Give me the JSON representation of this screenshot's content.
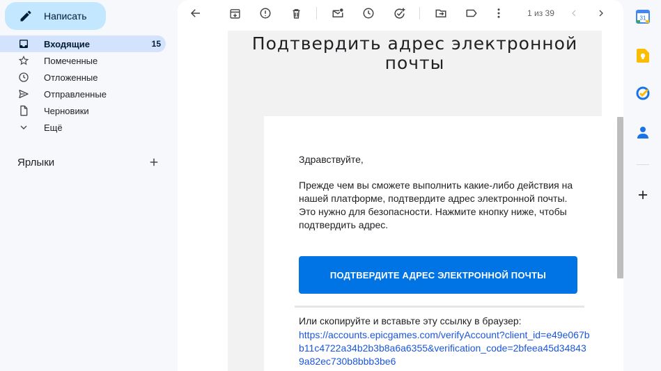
{
  "compose": {
    "label": "Написать"
  },
  "nav": [
    {
      "label": "Входящие",
      "count": "15",
      "icon": "inbox-icon",
      "active": true
    },
    {
      "label": "Помеченные",
      "icon": "star-icon"
    },
    {
      "label": "Отложенные",
      "icon": "clock-icon"
    },
    {
      "label": "Отправленные",
      "icon": "send-icon"
    },
    {
      "label": "Черновики",
      "icon": "draft-icon"
    },
    {
      "label": "Ещё",
      "icon": "chevron-down-icon"
    }
  ],
  "labels": {
    "title": "Ярлыки"
  },
  "toolbar": {
    "icons": [
      "back-arrow-icon",
      "archive-icon",
      "report-spam-icon",
      "delete-icon",
      "mark-unread-icon",
      "snooze-icon",
      "add-task-icon",
      "move-to-icon",
      "label-icon",
      "more-vert-icon"
    ],
    "pager": "1 из 39"
  },
  "email": {
    "title": "Подтвердить адрес электронной почты",
    "greeting": "Здравствуйте,",
    "body": "Прежде чем вы сможете выполнить какие-либо действия на нашей платформе, подтвердите адрес электронной почты. Это нужно для безопасности. Нажмите кнопку ниже, чтобы подтвердить адрес.",
    "button": "ПОДТВЕРДИТЕ АДРЕС ЭЛЕКТРОННОЙ ПОЧТЫ",
    "copy_text": "Или скопируйте и вставьте эту ссылку в браузер:",
    "link": "https://accounts.epicgames.com/verifyAccount?client_id=e49e067bb11c4722a34b2b3b8a6a6355&verification_code=2bfeea45d348439a82ec730b8bbb3be6"
  },
  "rail": {
    "calendar_day": "31",
    "icons": [
      "calendar-icon",
      "keep-icon",
      "tasks-icon",
      "contacts-icon",
      "add-addon-icon"
    ]
  },
  "colors": {
    "accent": "#0074e4",
    "compose_bg": "#c2e7ff",
    "active_nav": "#d3e3fd",
    "link": "#1a56db"
  }
}
